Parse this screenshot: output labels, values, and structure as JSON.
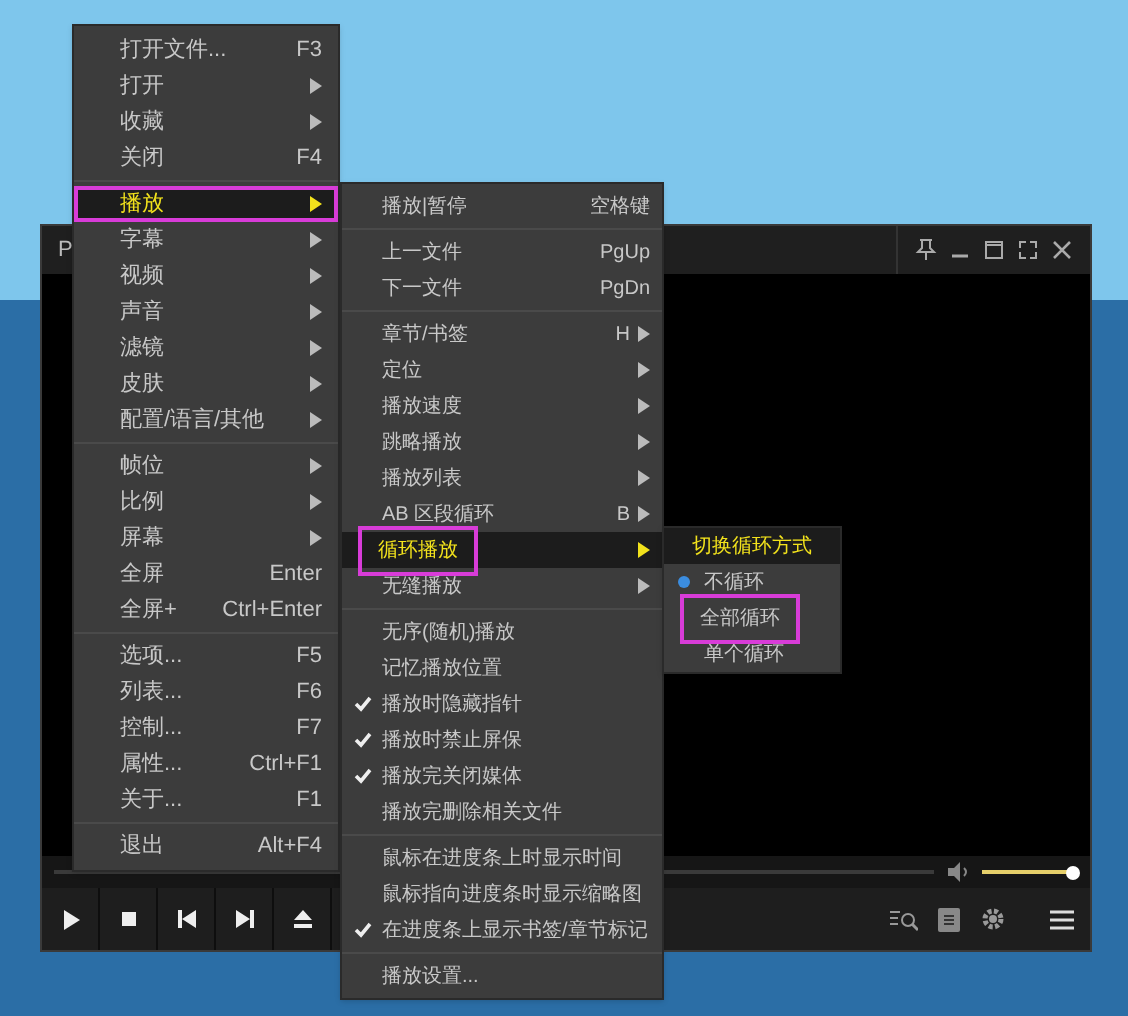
{
  "player": {
    "title": "P",
    "volume": {
      "level": 0.93
    }
  },
  "menus": [
    {
      "items": [
        {
          "kind": "item",
          "label": "打开文件...",
          "shortcut": "F3",
          "submenu": false,
          "highlighted": false,
          "outlined": false
        },
        {
          "kind": "item",
          "label": "打开",
          "submenu": true,
          "highlighted": false,
          "outlined": false
        },
        {
          "kind": "item",
          "label": "收藏",
          "submenu": true,
          "highlighted": false,
          "outlined": false
        },
        {
          "kind": "item",
          "label": "关闭",
          "shortcut": "F4",
          "submenu": false,
          "highlighted": false,
          "outlined": false
        },
        {
          "kind": "separator"
        },
        {
          "kind": "item",
          "label": "播放",
          "submenu": true,
          "highlighted": true,
          "outlined": true
        },
        {
          "kind": "item",
          "label": "字幕",
          "submenu": true,
          "highlighted": false,
          "outlined": false
        },
        {
          "kind": "item",
          "label": "视频",
          "submenu": true,
          "highlighted": false,
          "outlined": false
        },
        {
          "kind": "item",
          "label": "声音",
          "submenu": true,
          "highlighted": false,
          "outlined": false
        },
        {
          "kind": "item",
          "label": "滤镜",
          "submenu": true,
          "highlighted": false,
          "outlined": false
        },
        {
          "kind": "item",
          "label": "皮肤",
          "submenu": true,
          "highlighted": false,
          "outlined": false
        },
        {
          "kind": "item",
          "label": "配置/语言/其他",
          "submenu": true,
          "highlighted": false,
          "outlined": false
        },
        {
          "kind": "separator"
        },
        {
          "kind": "item",
          "label": "帧位",
          "submenu": true,
          "highlighted": false,
          "outlined": false
        },
        {
          "kind": "item",
          "label": "比例",
          "submenu": true,
          "highlighted": false,
          "outlined": false
        },
        {
          "kind": "item",
          "label": "屏幕",
          "submenu": true,
          "highlighted": false,
          "outlined": false
        },
        {
          "kind": "item",
          "label": "全屏",
          "shortcut": "Enter",
          "submenu": false,
          "highlighted": false,
          "outlined": false
        },
        {
          "kind": "item",
          "label": "全屏+",
          "shortcut": "Ctrl+Enter",
          "submenu": false,
          "highlighted": false,
          "outlined": false
        },
        {
          "kind": "separator"
        },
        {
          "kind": "item",
          "label": "选项...",
          "shortcut": "F5",
          "submenu": false,
          "highlighted": false,
          "outlined": false
        },
        {
          "kind": "item",
          "label": "列表...",
          "shortcut": "F6",
          "submenu": false,
          "highlighted": false,
          "outlined": false
        },
        {
          "kind": "item",
          "label": "控制...",
          "shortcut": "F7",
          "submenu": false,
          "highlighted": false,
          "outlined": false
        },
        {
          "kind": "item",
          "label": "属性...",
          "shortcut": "Ctrl+F1",
          "submenu": false,
          "highlighted": false,
          "outlined": false
        },
        {
          "kind": "item",
          "label": "关于...",
          "shortcut": "F1",
          "submenu": false,
          "highlighted": false,
          "outlined": false
        },
        {
          "kind": "separator"
        },
        {
          "kind": "item",
          "label": "退出",
          "shortcut": "Alt+F4",
          "submenu": false,
          "highlighted": false,
          "outlined": false
        }
      ]
    },
    {
      "items": [
        {
          "kind": "item",
          "label": "播放|暂停",
          "shortcut": "空格键",
          "submenu": false,
          "highlighted": false,
          "outlined": false,
          "checked": false
        },
        {
          "kind": "separator"
        },
        {
          "kind": "item",
          "label": "上一文件",
          "shortcut": "PgUp",
          "submenu": false,
          "highlighted": false,
          "outlined": false,
          "checked": false
        },
        {
          "kind": "item",
          "label": "下一文件",
          "shortcut": "PgDn",
          "submenu": false,
          "highlighted": false,
          "outlined": false,
          "checked": false
        },
        {
          "kind": "separator"
        },
        {
          "kind": "item",
          "label": "章节/书签",
          "shortcut": "H",
          "submenu": true,
          "highlighted": false,
          "outlined": false,
          "checked": false
        },
        {
          "kind": "item",
          "label": "定位",
          "submenu": true,
          "highlighted": false,
          "outlined": false,
          "checked": false
        },
        {
          "kind": "item",
          "label": "播放速度",
          "submenu": true,
          "highlighted": false,
          "outlined": false,
          "checked": false
        },
        {
          "kind": "item",
          "label": "跳略播放",
          "submenu": true,
          "highlighted": false,
          "outlined": false,
          "checked": false
        },
        {
          "kind": "item",
          "label": "播放列表",
          "submenu": true,
          "highlighted": false,
          "outlined": false,
          "checked": false
        },
        {
          "kind": "item",
          "label": "AB 区段循环",
          "shortcut": "B",
          "submenu": true,
          "highlighted": false,
          "outlined": false,
          "checked": false
        },
        {
          "kind": "item",
          "label": "循环播放",
          "submenu": true,
          "highlighted": true,
          "outlined": true,
          "checked": false
        },
        {
          "kind": "item",
          "label": "无缝播放",
          "submenu": true,
          "highlighted": false,
          "outlined": false,
          "checked": false
        },
        {
          "kind": "separator"
        },
        {
          "kind": "item",
          "label": "无序(随机)播放",
          "submenu": false,
          "highlighted": false,
          "outlined": false,
          "checked": false
        },
        {
          "kind": "item",
          "label": "记忆播放位置",
          "submenu": false,
          "highlighted": false,
          "outlined": false,
          "checked": false
        },
        {
          "kind": "item",
          "label": "播放时隐藏指针",
          "submenu": false,
          "highlighted": false,
          "outlined": false,
          "checked": true
        },
        {
          "kind": "item",
          "label": "播放时禁止屏保",
          "submenu": false,
          "highlighted": false,
          "outlined": false,
          "checked": true
        },
        {
          "kind": "item",
          "label": "播放完关闭媒体",
          "submenu": false,
          "highlighted": false,
          "outlined": false,
          "checked": true
        },
        {
          "kind": "item",
          "label": "播放完删除相关文件",
          "submenu": false,
          "highlighted": false,
          "outlined": false,
          "checked": false
        },
        {
          "kind": "separator"
        },
        {
          "kind": "item",
          "label": "鼠标在进度条上时显示时间",
          "submenu": false,
          "highlighted": false,
          "outlined": false,
          "checked": false
        },
        {
          "kind": "item",
          "label": "鼠标指向进度条时显示缩略图",
          "submenu": false,
          "highlighted": false,
          "outlined": false,
          "checked": false
        },
        {
          "kind": "item",
          "label": "在进度条上显示书签/章节标记",
          "submenu": false,
          "highlighted": false,
          "outlined": false,
          "checked": true
        },
        {
          "kind": "separator"
        },
        {
          "kind": "item",
          "label": "播放设置...",
          "submenu": false,
          "highlighted": false,
          "outlined": false,
          "checked": false
        }
      ]
    },
    {
      "items": [
        {
          "kind": "header",
          "label": "切换循环方式",
          "outlined": false
        },
        {
          "kind": "item",
          "label": "不循环",
          "selected": true,
          "outlined": false
        },
        {
          "kind": "item",
          "label": "全部循环",
          "selected": false,
          "outlined": true
        },
        {
          "kind": "item",
          "label": "单个循环",
          "selected": false,
          "outlined": false
        }
      ]
    }
  ]
}
